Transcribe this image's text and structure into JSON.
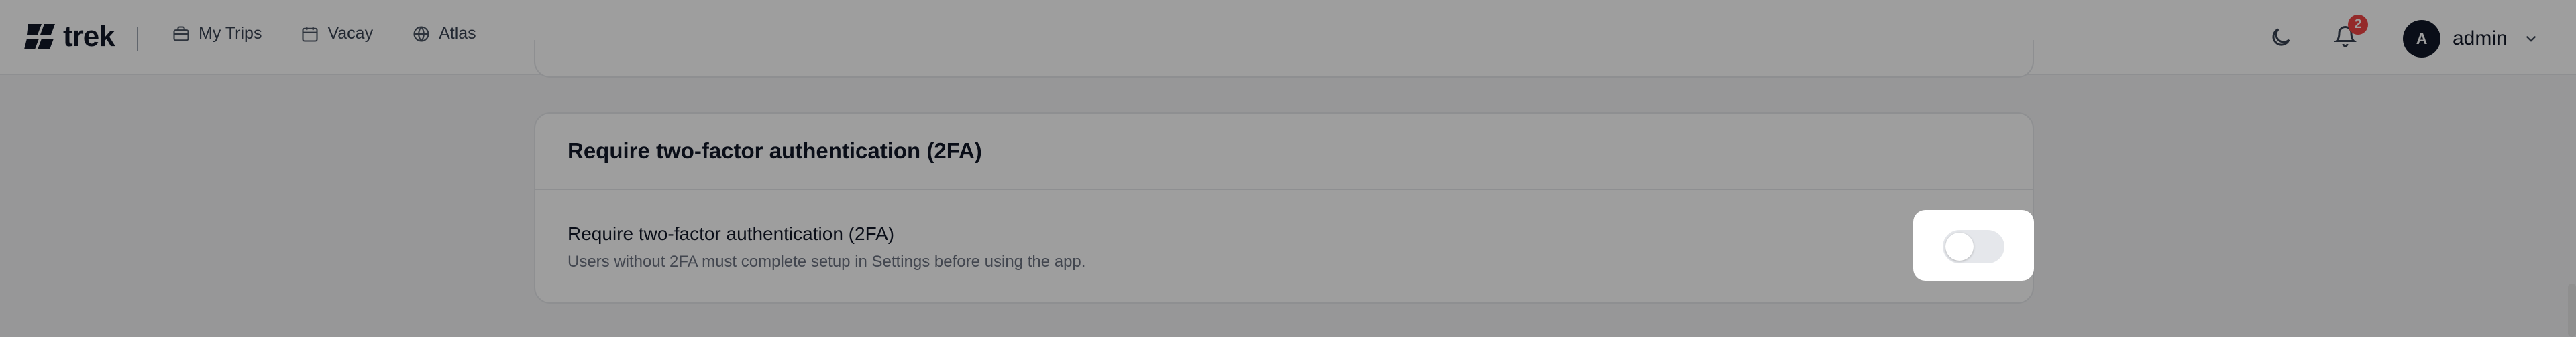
{
  "header": {
    "brand": "trek",
    "nav": [
      {
        "label": "My Trips",
        "icon": "briefcase-icon"
      },
      {
        "label": "Vacay",
        "icon": "calendar-icon"
      },
      {
        "label": "Atlas",
        "icon": "globe-icon"
      }
    ],
    "notifications_count": "2",
    "user": {
      "initial": "A",
      "name": "admin"
    }
  },
  "card": {
    "title": "Require two-factor authentication (2FA)",
    "setting": {
      "label": "Require two-factor authentication (2FA)",
      "description": "Users without 2FA must complete setup in Settings before using the app.",
      "enabled": false
    }
  },
  "colors": {
    "badge": "#ef4444",
    "avatar": "#111827",
    "toggle_off": "#e5e7eb",
    "overlay": "rgba(0,0,0,0.38)"
  }
}
